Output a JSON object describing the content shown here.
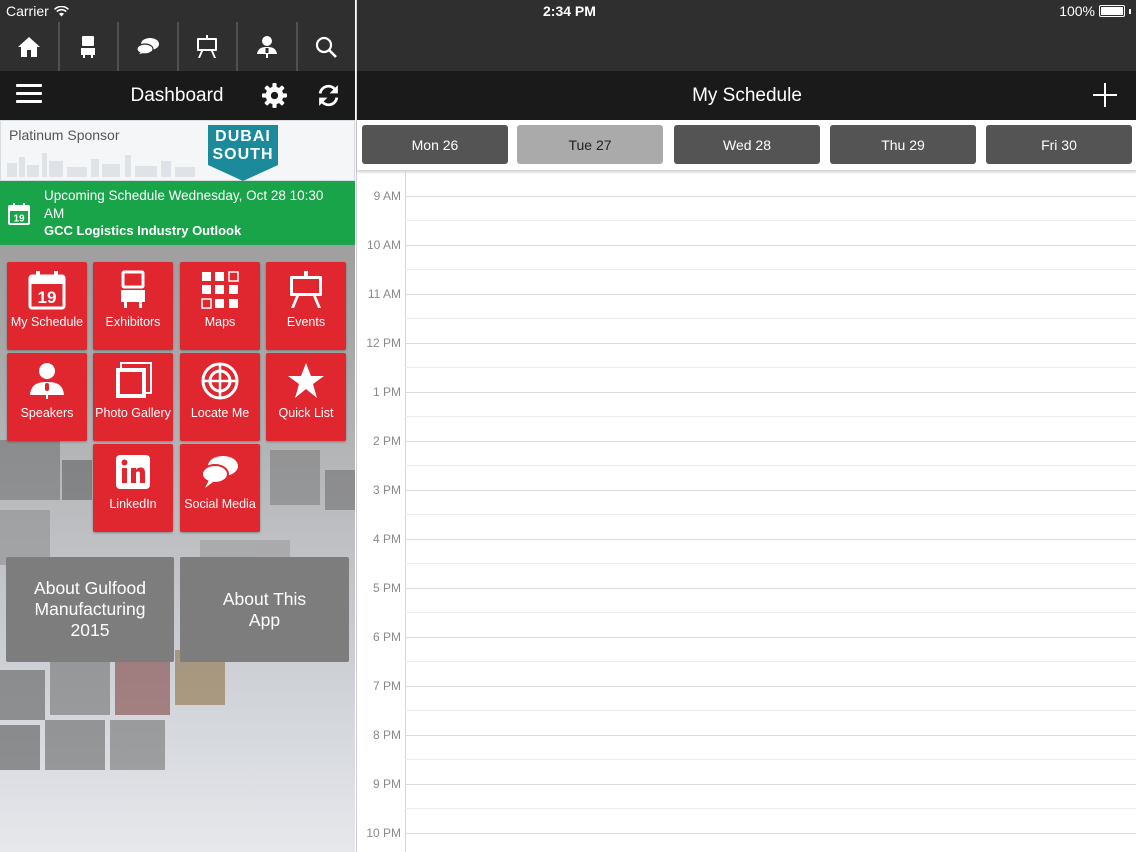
{
  "status": {
    "carrier": "Carrier",
    "time": "2:34 PM",
    "battery": "100%"
  },
  "toolbar": {
    "icons": [
      "home-icon",
      "exhibitor-booth-icon",
      "chat-bubbles-icon",
      "easel-icon",
      "speaker-icon",
      "search-icon"
    ]
  },
  "dashboard": {
    "title": "Dashboard"
  },
  "sponsor": {
    "label": "Platinum Sponsor",
    "logo_line1": "DUBAI",
    "logo_line2": "SOUTH",
    "logo_color": "#1b8a9a"
  },
  "upcoming": {
    "text": "Upcoming Schedule Wednesday, Oct 28 10:30 AM",
    "session": "GCC Logistics Industry Outlook",
    "calendar_day": "19",
    "color": "#1aa44a"
  },
  "tiles": [
    {
      "label": "My Schedule",
      "icon": "calendar-icon"
    },
    {
      "label": "Exhibitors",
      "icon": "booth-icon"
    },
    {
      "label": "Maps",
      "icon": "map-grid-icon"
    },
    {
      "label": "Events",
      "icon": "easel-icon"
    },
    {
      "label": "Speakers",
      "icon": "speaker-icon"
    },
    {
      "label": "Photo Gallery",
      "icon": "photo-icon"
    },
    {
      "label": "Locate Me",
      "icon": "target-icon"
    },
    {
      "label": "Quick List",
      "icon": "star-icon"
    },
    {
      "label": "LinkedIn",
      "icon": "linkedin-icon"
    },
    {
      "label": "Social Media",
      "icon": "chat-bubbles-icon"
    }
  ],
  "tile_color": "#e0262f",
  "about": {
    "event": "About Gulfood Manufacturing 2015",
    "app": "About This App"
  },
  "schedule": {
    "title": "My Schedule",
    "days": [
      {
        "label": "Mon 26",
        "selected": false
      },
      {
        "label": "Tue 27",
        "selected": true
      },
      {
        "label": "Wed 28",
        "selected": false
      },
      {
        "label": "Thu 29",
        "selected": false
      },
      {
        "label": "Fri 30",
        "selected": false
      }
    ],
    "hours": [
      "9 AM",
      "10 AM",
      "11 AM",
      "12 PM",
      "1 PM",
      "2 PM",
      "3 PM",
      "4 PM",
      "5 PM",
      "6 PM",
      "7 PM",
      "8 PM",
      "9 PM",
      "10 PM"
    ]
  }
}
